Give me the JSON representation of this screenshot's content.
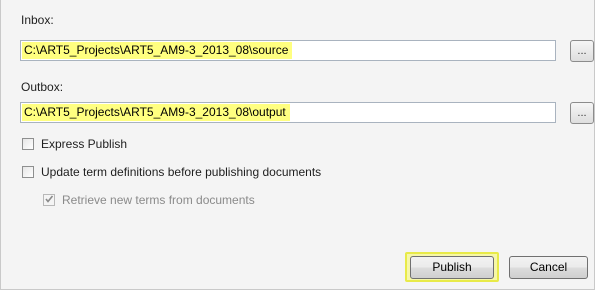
{
  "inbox": {
    "label": "Inbox:",
    "value": "C:\\ART5_Projects\\ART5_AM9-3_2013_08\\source",
    "browse_label": "..."
  },
  "outbox": {
    "label": "Outbox:",
    "value": "C:\\ART5_Projects\\ART5_AM9-3_2013_08\\output",
    "browse_label": "..."
  },
  "options": {
    "express_publish": {
      "label": "Express Publish",
      "checked": false,
      "enabled": true
    },
    "update_terms": {
      "label": "Update term definitions before publishing documents",
      "checked": false,
      "enabled": true
    },
    "retrieve_terms": {
      "label": "Retrieve new terms from documents",
      "checked": true,
      "enabled": false
    }
  },
  "buttons": {
    "publish_label": "Publish",
    "cancel_label": "Cancel"
  },
  "colors": {
    "highlight": "#ffff80",
    "dialog_background": "#f4f4f4"
  }
}
